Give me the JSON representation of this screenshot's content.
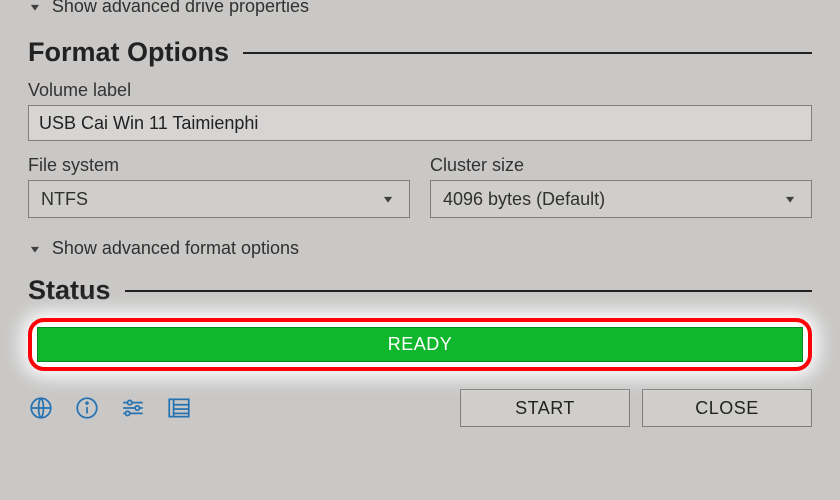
{
  "drive": {
    "advanced_label": "Show advanced drive properties"
  },
  "format": {
    "heading": "Format Options",
    "volume_label_caption": "Volume label",
    "volume_label_value": "USB Cai Win 11 Taimienphi",
    "file_system_caption": "File system",
    "file_system_value": "NTFS",
    "cluster_size_caption": "Cluster size",
    "cluster_size_value": "4096 bytes (Default)",
    "advanced_label": "Show advanced format options"
  },
  "status": {
    "heading": "Status",
    "value": "READY",
    "color": "#0fb72c"
  },
  "footer": {
    "start_label": "START",
    "close_label": "CLOSE"
  }
}
